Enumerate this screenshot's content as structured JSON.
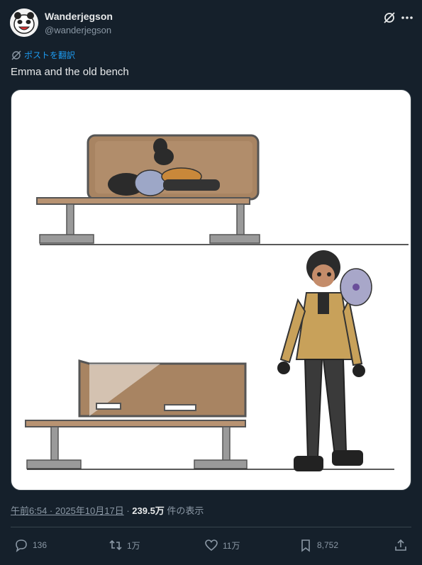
{
  "author": {
    "display_name": "Wanderjegson",
    "handle": "@wanderjegson"
  },
  "translate_label": "ポストを翻訳",
  "post_text": "Emma and the old bench",
  "meta": {
    "timestamp": "午前6:54 · 2025年10月17日",
    "separator": " · ",
    "views": "239.5万",
    "views_suffix": " 件の表示"
  },
  "actions": {
    "replies": "136",
    "reposts": "1万",
    "likes": "11万",
    "bookmarks": "8,752"
  },
  "icons": [
    "grok-icon",
    "more-icon",
    "translate-icon",
    "reply-icon",
    "repost-icon",
    "like-icon",
    "bookmark-icon",
    "share-icon"
  ],
  "colors": {
    "background": "#15202b",
    "accent": "#1d9bf0",
    "muted": "#8b98a5",
    "text": "#e7e9ea"
  }
}
